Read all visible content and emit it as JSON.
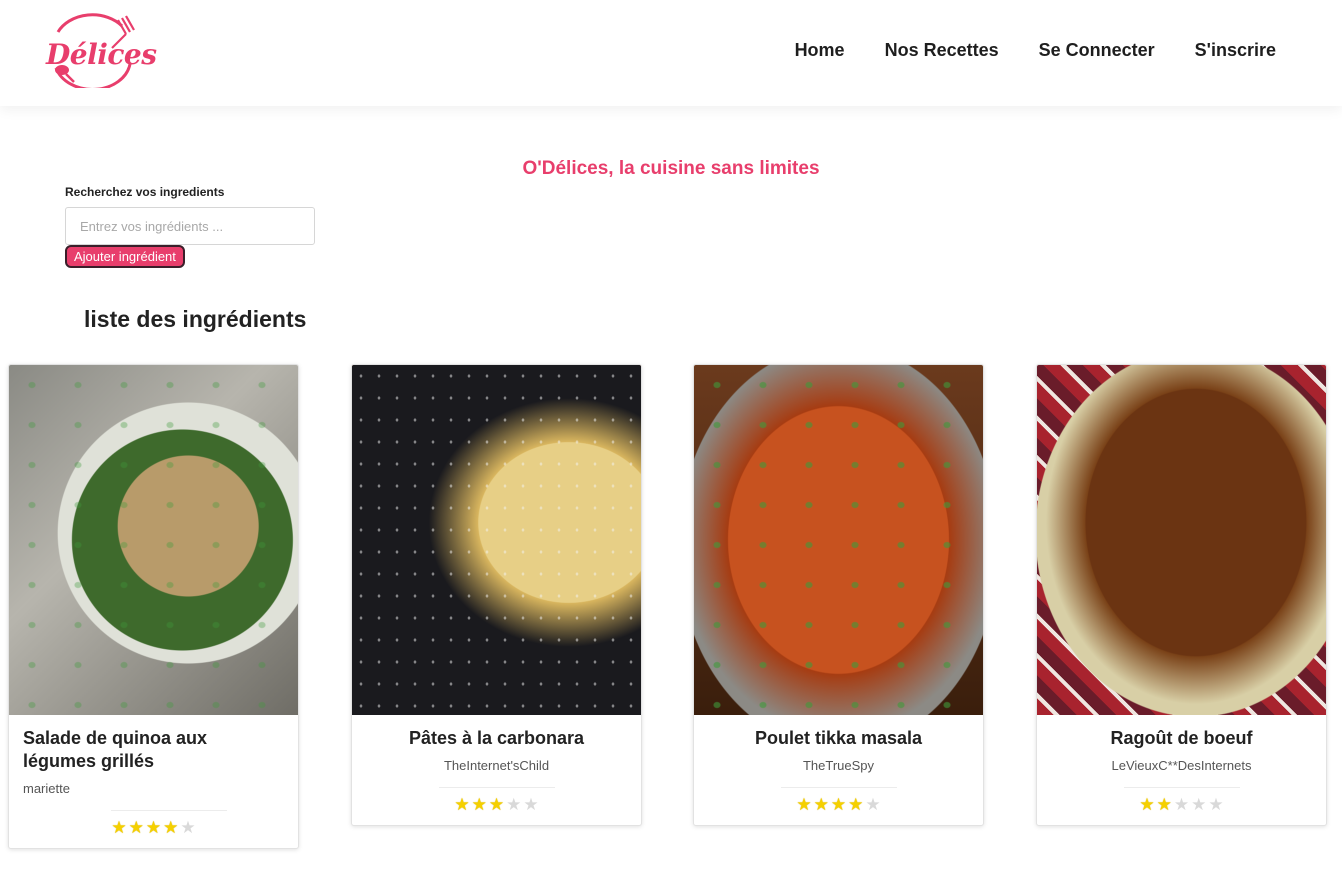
{
  "header": {
    "logo_text": "Délices",
    "nav": [
      "Home",
      "Nos Recettes",
      "Se Connecter",
      "S'inscrire"
    ]
  },
  "hero": {
    "tagline": "O'Délices, la cuisine sans limites"
  },
  "search": {
    "label": "Recherchez vos ingredients",
    "placeholder": "Entrez vos ingrédients ...",
    "value": "",
    "button_label": "Ajouter ingrédient"
  },
  "list_title": "liste des ingrédients",
  "colors": {
    "accent": "#e83e6c",
    "star_on": "#f5d000",
    "star_off": "#d9d9d9"
  },
  "recipes": [
    {
      "title": "Salade de quinoa aux légumes grillés",
      "author": "mariette",
      "rating": 4,
      "max_rating": 5
    },
    {
      "title": "Pâtes à la carbonara",
      "author": "TheInternet'sChild",
      "rating": 3,
      "max_rating": 5
    },
    {
      "title": "Poulet tikka masala",
      "author": "TheTrueSpy",
      "rating": 4,
      "max_rating": 5
    },
    {
      "title": "Ragoût de boeuf",
      "author": "LeVieuxC**DesInternets",
      "rating": 2,
      "max_rating": 5
    }
  ]
}
